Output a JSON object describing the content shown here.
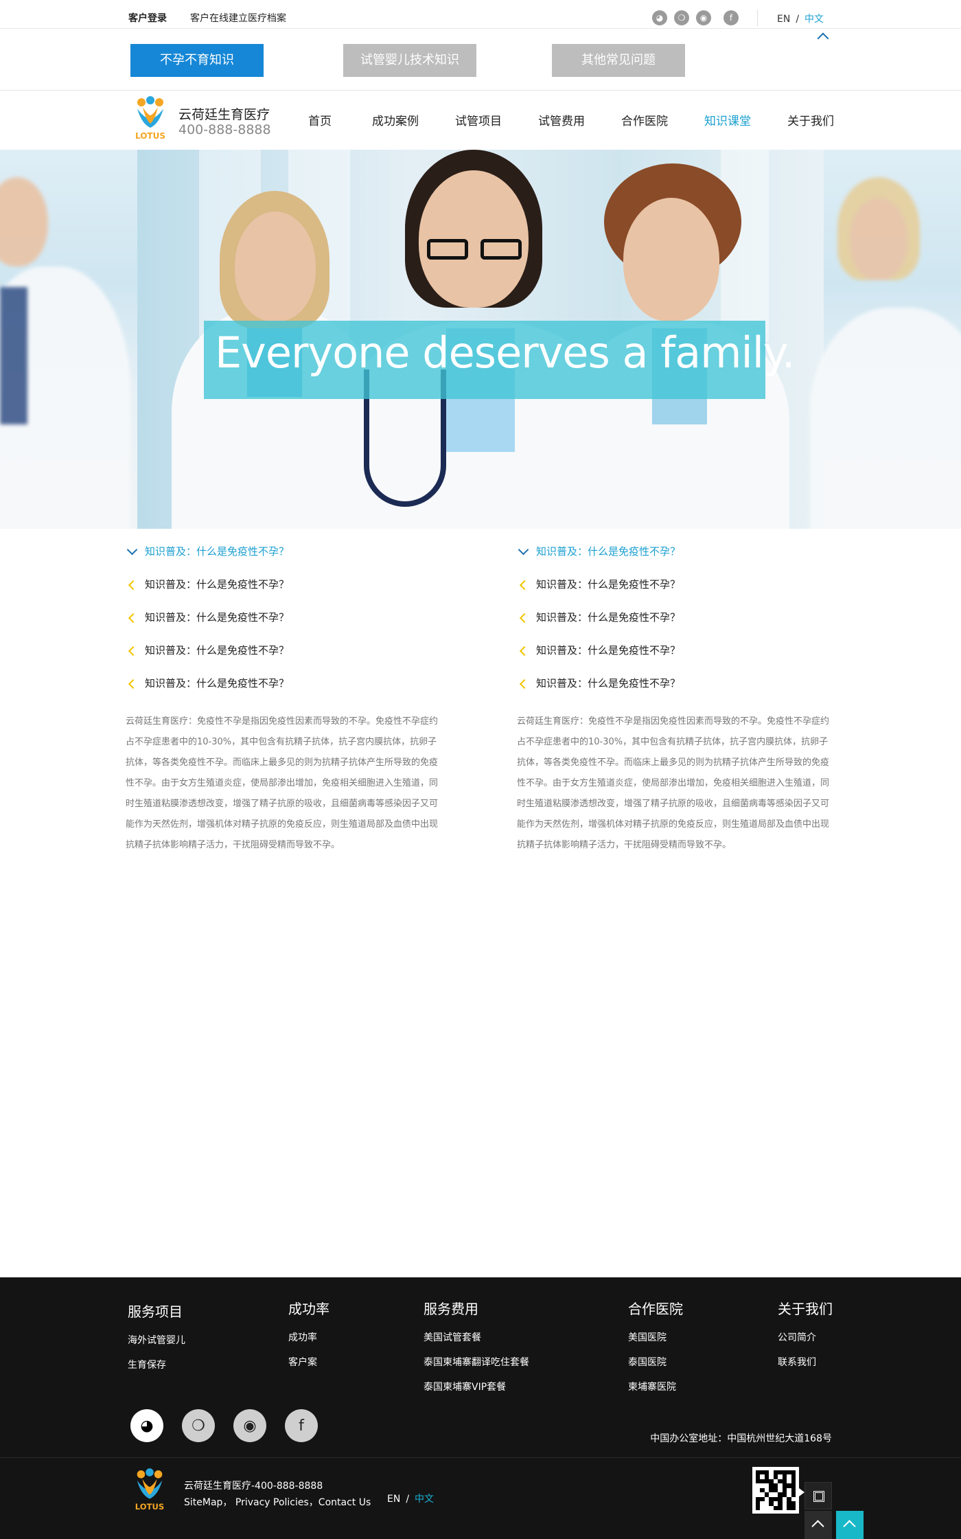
{
  "topbar": {
    "login": "客户登录",
    "archive": "客户在线建立医疗档案",
    "social_icons": [
      "qq-icon",
      "wechat-icon",
      "weibo-icon",
      "facebook-icon"
    ],
    "lang_en": "EN",
    "lang_sep": "/",
    "lang_zh": "中文"
  },
  "category_tabs": [
    {
      "label": "不孕不育知识",
      "active": true
    },
    {
      "label": "试管婴儿技术知识",
      "active": false
    },
    {
      "label": "其他常见问题",
      "active": false
    }
  ],
  "brand": {
    "name": "云荷廷生育医疗",
    "phone": "400-888-8888",
    "logo_text": "LOTUS"
  },
  "nav": [
    {
      "label": "首页",
      "active": false
    },
    {
      "label": "成功案例",
      "active": false
    },
    {
      "label": "试管项目",
      "active": false
    },
    {
      "label": "试管费用",
      "active": false
    },
    {
      "label": "合作医院",
      "active": false
    },
    {
      "label": "知识课堂",
      "active": true
    },
    {
      "label": "关于我们",
      "active": false
    }
  ],
  "hero": {
    "slogan": "Everyone deserves a family."
  },
  "faq_columns": [
    {
      "items": [
        {
          "label": "知识普及：什么是免疫性不孕？",
          "expanded": true
        },
        {
          "label": "知识普及：什么是免疫性不孕？",
          "expanded": false
        },
        {
          "label": "知识普及：什么是免疫性不孕？",
          "expanded": false
        },
        {
          "label": "知识普及：什么是免疫性不孕？",
          "expanded": false
        },
        {
          "label": "知识普及：什么是免疫性不孕？",
          "expanded": false
        }
      ],
      "text": "云荷廷生育医疗：免疫性不孕是指因免疫性因素而导致的不孕。免疫性不孕症约占不孕症患者中的10-30%，其中包含有抗精子抗体，抗子宫内膜抗体，抗卵子抗体，等各类免疫性不孕。而临床上最多见的则为抗精子抗体产生所导致的免疫性不孕。由于女方生殖道炎症，使局部渗出增加，免疫相关细胞进入生殖道，同时生殖道粘膜渗透想改变，增强了精子抗原的吸收，且细菌病毒等感染因子又可能作为天然佐剂，增强机体对精子抗原的免疫反应，则生殖道局部及血债中出现抗精子抗体影响精子活力，干扰阻碍受精而导致不孕。"
    },
    {
      "items": [
        {
          "label": "知识普及：什么是免疫性不孕？",
          "expanded": true
        },
        {
          "label": "知识普及：什么是免疫性不孕？",
          "expanded": false
        },
        {
          "label": "知识普及：什么是免疫性不孕？",
          "expanded": false
        },
        {
          "label": "知识普及：什么是免疫性不孕？",
          "expanded": false
        },
        {
          "label": "知识普及：什么是免疫性不孕？",
          "expanded": false
        }
      ],
      "text": "云荷廷生育医疗：免疫性不孕是指因免疫性因素而导致的不孕。免疫性不孕症约占不孕症患者中的10-30%，其中包含有抗精子抗体，抗子宫内膜抗体，抗卵子抗体，等各类免疫性不孕。而临床上最多见的则为抗精子抗体产生所导致的免疫性不孕。由于女方生殖道炎症，使局部渗出增加，免疫相关细胞进入生殖道，同时生殖道粘膜渗透想改变，增强了精子抗原的吸收，且细菌病毒等感染因子又可能作为天然佐剂，增强机体对精子抗原的免疫反应，则生殖道局部及血债中出现抗精子抗体影响精子活力，干扰阻碍受精而导致不孕。"
    }
  ],
  "footer": {
    "columns": [
      {
        "heading": "服务项目",
        "links": [
          "海外试管婴儿",
          "生育保存"
        ]
      },
      {
        "heading": "成功率",
        "links": [
          "成功率",
          "客户案"
        ]
      },
      {
        "heading": "服务费用",
        "links": [
          "美国试管套餐",
          "泰国柬埔寨翻译吃住套餐",
          "泰国柬埔寨VIP套餐"
        ]
      },
      {
        "heading": "合作医院",
        "links": [
          "美国医院",
          "泰国医院",
          "柬埔寨医院"
        ]
      },
      {
        "heading": "关于我们",
        "links": [
          "公司简介",
          "联系我们"
        ]
      }
    ],
    "social_icons": [
      "qq-icon",
      "wechat-icon",
      "weibo-icon",
      "facebook-icon"
    ],
    "address": "中国办公室地址：中国杭州世纪大道168号",
    "brand_line": "云荷廷生育医疗-400-888-8888",
    "links_line": "SiteMap， Privacy Policies，Contact Us",
    "lang_en": "EN",
    "lang_sep": "/",
    "lang_zh": "中文"
  },
  "colors": {
    "accent": "#1a9fd0",
    "tab_active": "#1687d6",
    "tab_inactive": "#bdbdbd",
    "hero_banner": "#40c4d6",
    "footer_bg": "#141414",
    "back_to_top": "#19b8c8",
    "faq_chevron": "#f2c500"
  }
}
